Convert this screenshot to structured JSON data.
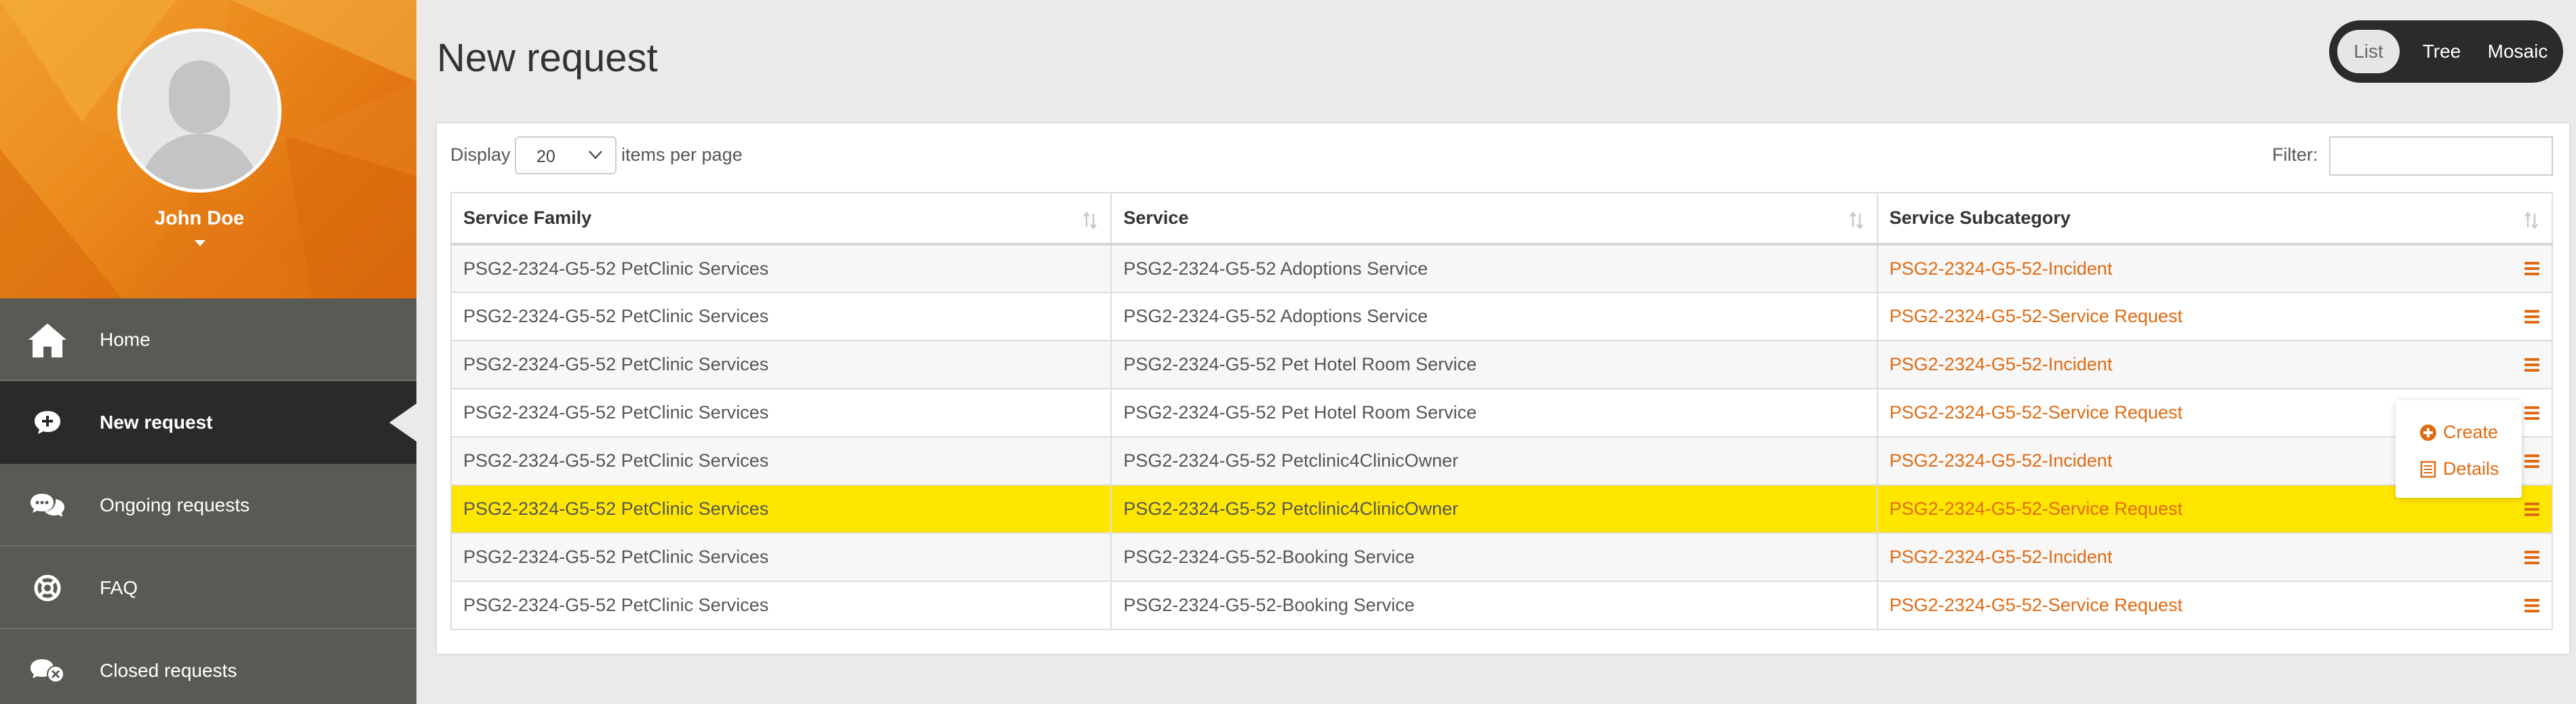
{
  "user": {
    "name": "John Doe"
  },
  "nav": [
    {
      "label": "Home",
      "icon": "home-icon",
      "active": false
    },
    {
      "label": "New request",
      "icon": "plus-bubble-icon",
      "active": true
    },
    {
      "label": "Ongoing requests",
      "icon": "chat-bubbles-icon",
      "active": false
    },
    {
      "label": "FAQ",
      "icon": "lifebuoy-icon",
      "active": false
    },
    {
      "label": "Closed requests",
      "icon": "closed-bubble-icon",
      "active": false
    }
  ],
  "page": {
    "title": "New request"
  },
  "view_switch": {
    "options": [
      "List",
      "Tree",
      "Mosaic"
    ],
    "selected": "List"
  },
  "toolbar": {
    "display_label": "Display",
    "per_page_value": "20",
    "per_page_suffix": "items per page",
    "filter_label": "Filter:",
    "filter_value": ""
  },
  "table": {
    "headers": [
      "Service Family",
      "Service",
      "Service Subcategory"
    ],
    "rows": [
      {
        "family": "PSG2-2324-G5-52 PetClinic Services",
        "service": "PSG2-2324-G5-52 Adoptions Service",
        "subcategory": "PSG2-2324-G5-52-Incident"
      },
      {
        "family": "PSG2-2324-G5-52 PetClinic Services",
        "service": "PSG2-2324-G5-52 Adoptions Service",
        "subcategory": "PSG2-2324-G5-52-Service Request"
      },
      {
        "family": "PSG2-2324-G5-52 PetClinic Services",
        "service": "PSG2-2324-G5-52 Pet Hotel Room Service",
        "subcategory": "PSG2-2324-G5-52-Incident"
      },
      {
        "family": "PSG2-2324-G5-52 PetClinic Services",
        "service": "PSG2-2324-G5-52 Pet Hotel Room Service",
        "subcategory": "PSG2-2324-G5-52-Service Request"
      },
      {
        "family": "PSG2-2324-G5-52 PetClinic Services",
        "service": "PSG2-2324-G5-52 Petclinic4ClinicOwner",
        "subcategory": "PSG2-2324-G5-52-Incident"
      },
      {
        "family": "PSG2-2324-G5-52 PetClinic Services",
        "service": "PSG2-2324-G5-52 Petclinic4ClinicOwner",
        "subcategory": "PSG2-2324-G5-52-Service Request"
      },
      {
        "family": "PSG2-2324-G5-52 PetClinic Services",
        "service": "PSG2-2324-G5-52-Booking Service",
        "subcategory": "PSG2-2324-G5-52-Incident"
      },
      {
        "family": "PSG2-2324-G5-52 PetClinic Services",
        "service": "PSG2-2324-G5-52-Booking Service",
        "subcategory": "PSG2-2324-G5-52-Service Request"
      }
    ],
    "highlighted_row": 5
  },
  "row_menu": {
    "items": [
      {
        "label": "Create",
        "icon": "plus-circle-icon"
      },
      {
        "label": "Details",
        "icon": "document-list-icon"
      }
    ]
  },
  "colors": {
    "accent": "#e06a12",
    "highlight": "#ffe600",
    "sidebar": "#5a5a55",
    "sidebar_active": "#2a2a2a",
    "profile_orange": "#ec8a1c"
  }
}
